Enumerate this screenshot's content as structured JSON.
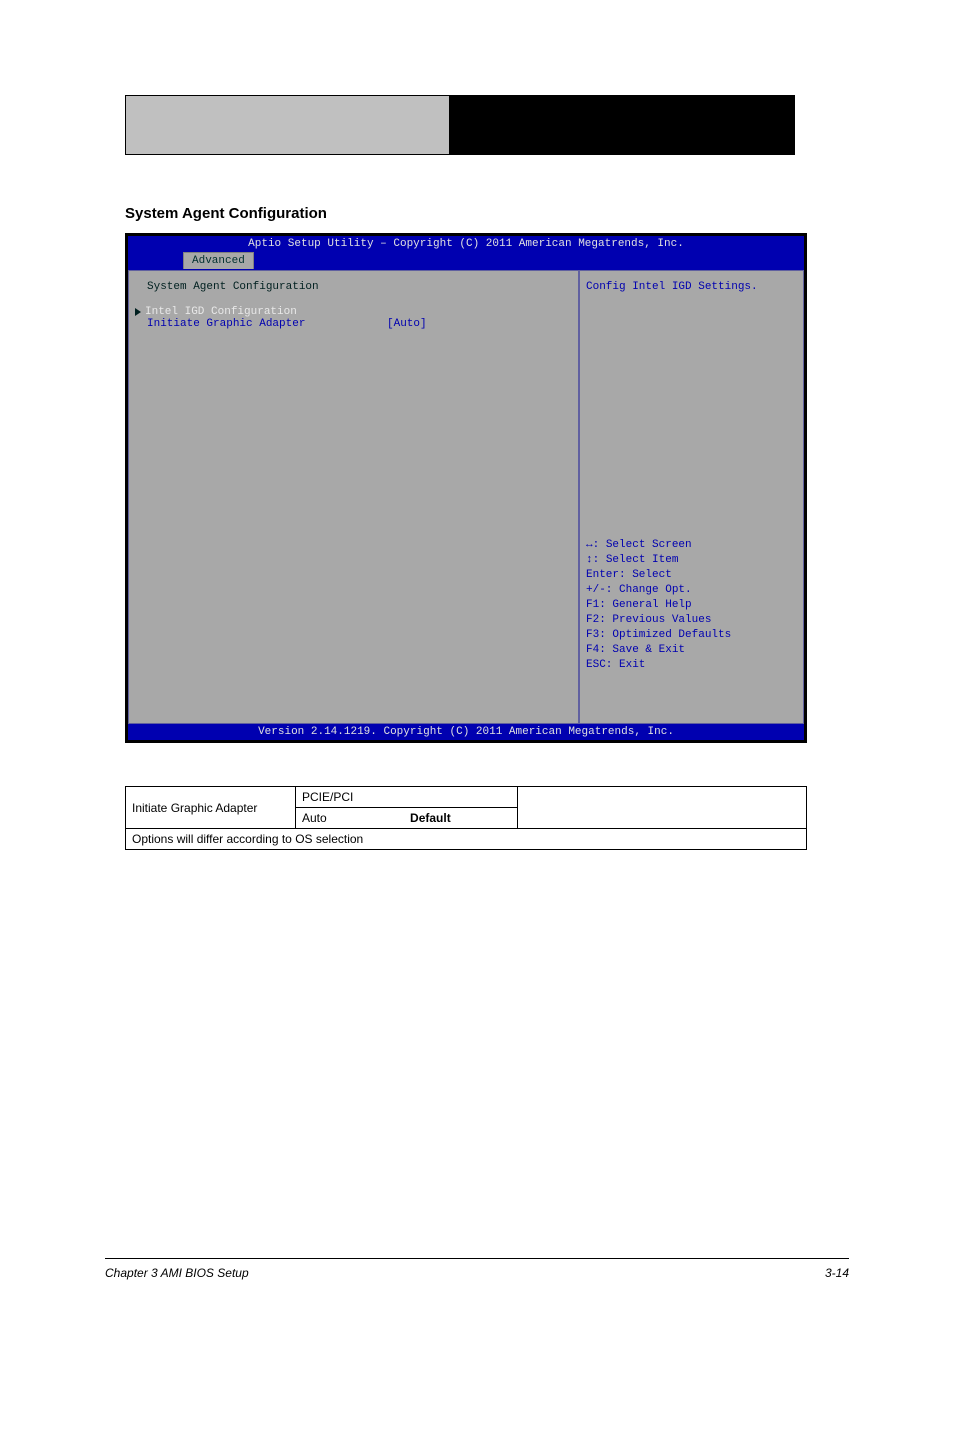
{
  "section_title": "System Agent Configuration",
  "bios": {
    "title": "Aptio Setup Utility – Copyright (C) 2011 American Megatrends, Inc.",
    "tab": "Advanced",
    "heading": "System Agent Configuration",
    "submenu": "Intel IGD Configuration",
    "option_label": "Initiate Graphic Adapter",
    "option_value": "[Auto]",
    "help_text": "Config Intel IGD Settings.",
    "keys": {
      "k1": "Select Screen",
      "k2": "Select Item",
      "k3": "Enter: Select",
      "k4": "+/-: Change Opt.",
      "k5": "F1: General Help",
      "k6": "F2: Previous Values",
      "k7": "F3: Optimized Defaults",
      "k8": "F4: Save & Exit",
      "k9": "ESC: Exit"
    },
    "footer": "Version 2.14.1219. Copyright (C) 2011 American Megatrends, Inc."
  },
  "table": {
    "row1_col1": "Initiate Graphic Adapter",
    "row1a_col2": "PCIE/PCI",
    "row1a_col3": "",
    "row1b_col2": "Auto",
    "row1b_col2_marker": "Default",
    "row2": "Options will differ according to OS selection"
  },
  "footer": {
    "left": "Chapter 3 AMI BIOS Setup",
    "right": "3-14"
  }
}
